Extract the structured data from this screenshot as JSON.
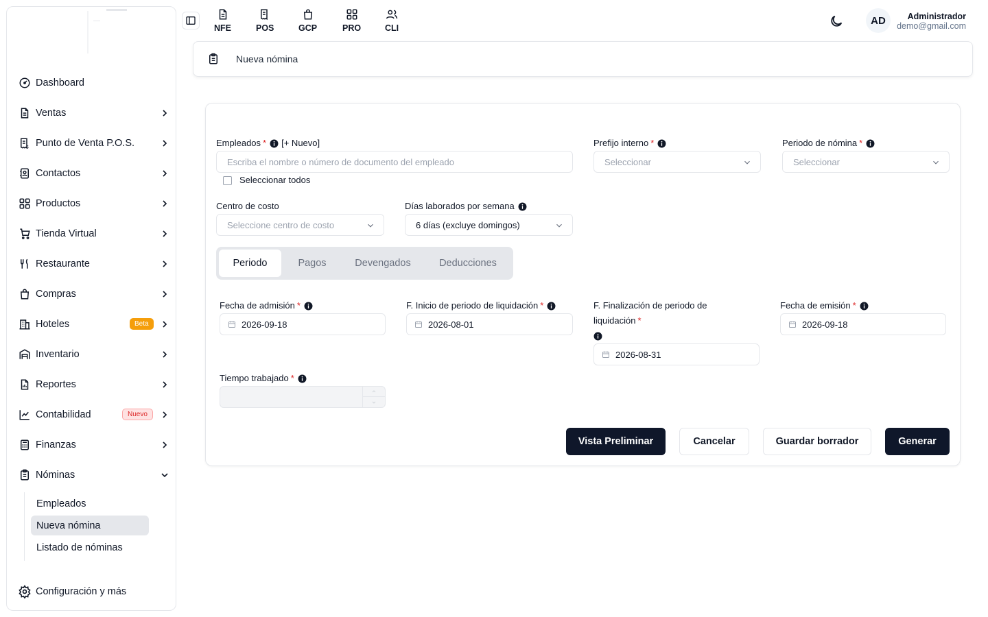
{
  "sidebar": {
    "items": [
      {
        "label": "Dashboard",
        "icon": "gauge-icon"
      },
      {
        "label": "Ventas",
        "icon": "document-icon"
      },
      {
        "label": "Punto de Venta P.O.S.",
        "icon": "pos-receipt-icon"
      },
      {
        "label": "Contactos",
        "icon": "contacts-icon"
      },
      {
        "label": "Productos",
        "icon": "grid-icon"
      },
      {
        "label": "Tienda Virtual",
        "icon": "cart-icon"
      },
      {
        "label": "Restaurante",
        "icon": "utensils-icon"
      },
      {
        "label": "Compras",
        "icon": "shopping-bag-icon"
      },
      {
        "label": "Hoteles",
        "icon": "hotel-icon",
        "badge": "Beta"
      },
      {
        "label": "Inventario",
        "icon": "warehouse-icon"
      },
      {
        "label": "Reportes",
        "icon": "report-icon"
      },
      {
        "label": "Contabilidad",
        "icon": "chart-icon",
        "badge": "Nuevo"
      },
      {
        "label": "Finanzas",
        "icon": "calculator-icon"
      },
      {
        "label": "Nóminas",
        "icon": "clipboard-icon"
      }
    ],
    "submenu": [
      "Empleados",
      "Nueva nómina",
      "Listado de nóminas"
    ],
    "footer": "Configuración y más"
  },
  "topbar": {
    "shortcuts": [
      "NFE",
      "POS",
      "GCP",
      "PRO",
      "CLI"
    ],
    "user_initials": "AD",
    "user_name": "Administrador",
    "user_email": "demo@gmail.com"
  },
  "breadcrumb": "Nueva nómina",
  "form": {
    "empleados_label": "Empleados",
    "empleados_new": "[+ Nuevo]",
    "empleados_placeholder": "Escriba el nombre o número de documento del empleado",
    "select_all": "Seleccionar todos",
    "prefijo_label": "Prefijo interno",
    "prefijo_placeholder": "Seleccionar",
    "periodo_label": "Periodo de nómina",
    "periodo_placeholder": "Seleccionar",
    "centro_label": "Centro de costo",
    "centro_placeholder": "Seleccione centro de costo",
    "dias_label": "Días laborados por semana",
    "dias_value": "6 días (excluye domingos)",
    "tabs": [
      "Periodo",
      "Pagos",
      "Devengados",
      "Deducciones"
    ],
    "admision_label": "Fecha de admisión",
    "admision_value": "2026-09-18",
    "inicio_label": "F. Inicio de periodo de liquidación",
    "inicio_value": "2026-08-01",
    "fin_label_1": "F. Finalización de periodo de",
    "fin_label_2": "liquidación",
    "fin_value": "2026-08-31",
    "emision_label": "Fecha de emisión",
    "emision_value": "2026-09-18",
    "tiempo_label": "Tiempo trabajado",
    "required_mark": "*"
  },
  "buttons": {
    "preview": "Vista Preliminar",
    "cancel": "Cancelar",
    "draft": "Guardar borrador",
    "generate": "Generar"
  },
  "colors": {
    "primary_dark": "#0f172a",
    "beta_badge": "#f59e0b",
    "nuevo_badge": "#dc2626",
    "required": "#dc2626"
  }
}
